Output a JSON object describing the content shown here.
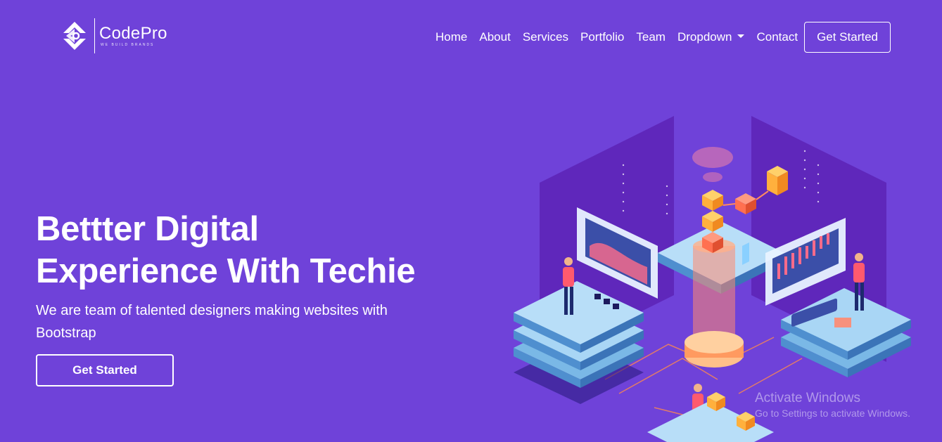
{
  "brand": {
    "name": "CodePro",
    "tagline": "WE BUILD BRANDS"
  },
  "nav": {
    "items": [
      {
        "label": "Home"
      },
      {
        "label": "About"
      },
      {
        "label": "Services"
      },
      {
        "label": "Portfolio"
      },
      {
        "label": "Team"
      },
      {
        "label": "Dropdown"
      },
      {
        "label": "Contact"
      }
    ],
    "cta_label": "Get Started"
  },
  "hero": {
    "title_line1": "Bettter Digital",
    "title_line2": "Experience With Techie",
    "subtitle": "We are team of talented designers making websites with Bootstrap",
    "cta_label": "Get Started"
  },
  "watermark": {
    "title": "Activate Windows",
    "subtitle": "Go to Settings to activate Windows."
  },
  "colors": {
    "background": "#6f42d9",
    "accent_orange": "#ff8a4c",
    "accent_yellow": "#ffc23d",
    "platform_blue": "#9fd0f0"
  },
  "icons": [
    "codepro-logo-icon",
    "dropdown-caret-icon"
  ]
}
